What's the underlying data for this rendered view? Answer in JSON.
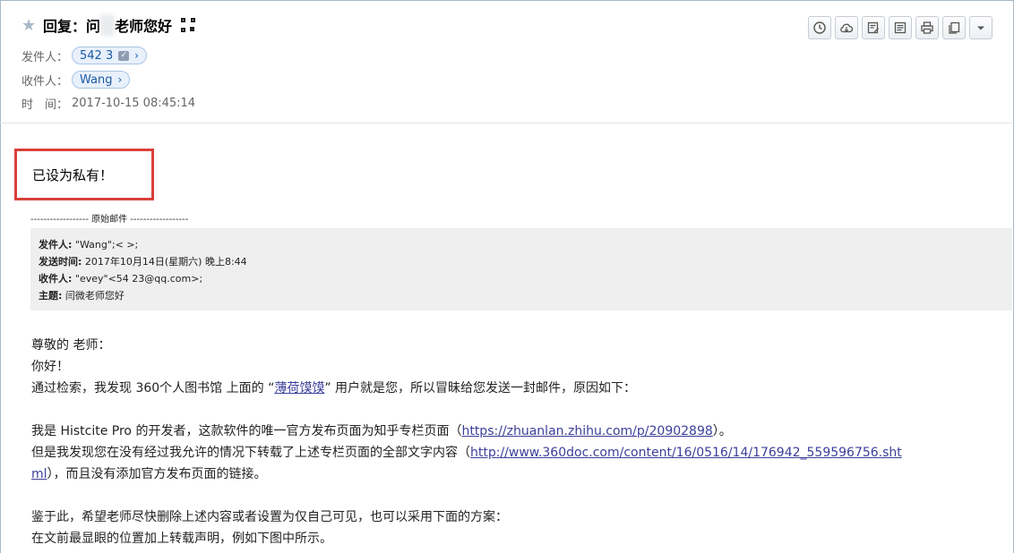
{
  "header": {
    "subject_prefix": "回复：问",
    "subject_rest": "老师您好",
    "sender_label": "发件人：",
    "sender_name": "542        3",
    "receiver_label": "收件人：",
    "receiver_name": "Wang",
    "time_label": "时　间：",
    "time_value": "2017-10-15 08:45:14"
  },
  "toolbar": {
    "icons": [
      "clock-icon",
      "cloud-icon",
      "edit-note-icon",
      "note-icon",
      "print-icon",
      "copy-icon",
      "dropdown-icon"
    ]
  },
  "body": {
    "private_notice": "已设为私有！",
    "original_separator": "------------------ 原始邮件 ------------------",
    "quote": {
      "from_label": "发件人:",
      "from_value": "\"Wang\";<                    >;",
      "sent_label": "发送时间:",
      "sent_value": "2017年10月14日(星期六) 晚上8:44",
      "to_label": "收件人:",
      "to_value": "\"evey\"<54       23@qq.com>;",
      "subject_label": "主题:",
      "subject_value": "闫微老师您好"
    },
    "letter": {
      "greeting": "尊敬的     老师：",
      "hello": "你好！",
      "line1_pre": "通过检索，我发现 360个人图书馆 上面的 “",
      "line1_link": "薄荷馍馍",
      "line1_post": "” 用户就是您，所以冒昧给您发送一封邮件，原因如下：",
      "line2_pre": "我是 Histcite Pro 的开发者，这款软件的唯一官方发布页面为知乎专栏页面（",
      "line2_link": "https://zhuanlan.zhihu.com/p/20902898",
      "line2_post": "）。",
      "line3_pre": "但是我发现您在没有经过我允许的情况下转载了上述专栏页面的全部文字内容（",
      "line3_link_a": "http://www.360doc.com/content/16/0516/14/176942_559596756.sht",
      "line3_link_b": "ml",
      "line3_post": "），而且没有添加官方发布页面的链接。",
      "line4": "鉴于此，希望老师尽快删除上述内容或者设置为仅自己可见，也可以采用下面的方案：",
      "line5": "在文前最显眼的位置加上转载声明，例如下图中所示。"
    }
  },
  "colors": {
    "highlight_border": "#d9403a",
    "link": "#3b3f99",
    "chip_text": "#1a5aa6"
  }
}
